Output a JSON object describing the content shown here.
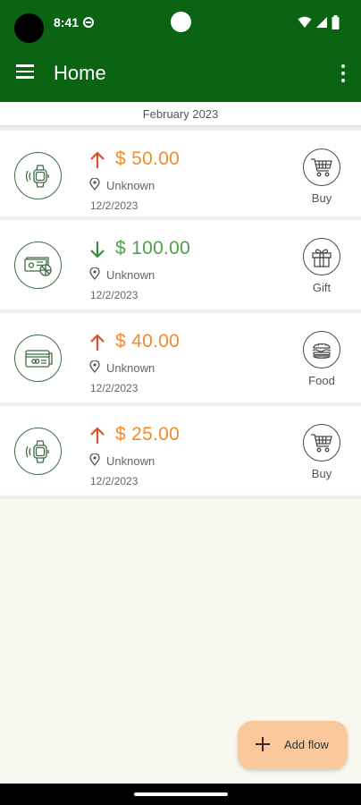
{
  "status_bar": {
    "time": "8:41"
  },
  "app_bar": {
    "title": "Home"
  },
  "month_header": "February 2023",
  "transactions": [
    {
      "direction": "out",
      "amount": "$ 50.00",
      "location": "Unknown",
      "date": "12/2/2023",
      "method_icon": "smartwatch-icon",
      "category": "Buy",
      "category_icon": "shopping-cart-icon",
      "color": "#f08c2c"
    },
    {
      "direction": "in",
      "amount": "$ 100.00",
      "location": "Unknown",
      "date": "12/2/2023",
      "method_icon": "cash-icon",
      "category": "Gift",
      "category_icon": "gift-icon",
      "color": "#4ca04c"
    },
    {
      "direction": "out",
      "amount": "$ 40.00",
      "location": "Unknown",
      "date": "12/2/2023",
      "method_icon": "credit-card-icon",
      "category": "Food",
      "category_icon": "burger-icon",
      "color": "#f08c2c"
    },
    {
      "direction": "out",
      "amount": "$ 25.00",
      "location": "Unknown",
      "date": "12/2/2023",
      "method_icon": "smartwatch-icon",
      "category": "Buy",
      "category_icon": "shopping-cart-icon",
      "color": "#f08c2c"
    }
  ],
  "fab": {
    "label": "Add flow"
  },
  "colors": {
    "primary": "#0b6414",
    "expense": "#f08c2c",
    "income": "#4ca04c",
    "background": "#f8f8f1",
    "fab": "#fbc89b"
  }
}
